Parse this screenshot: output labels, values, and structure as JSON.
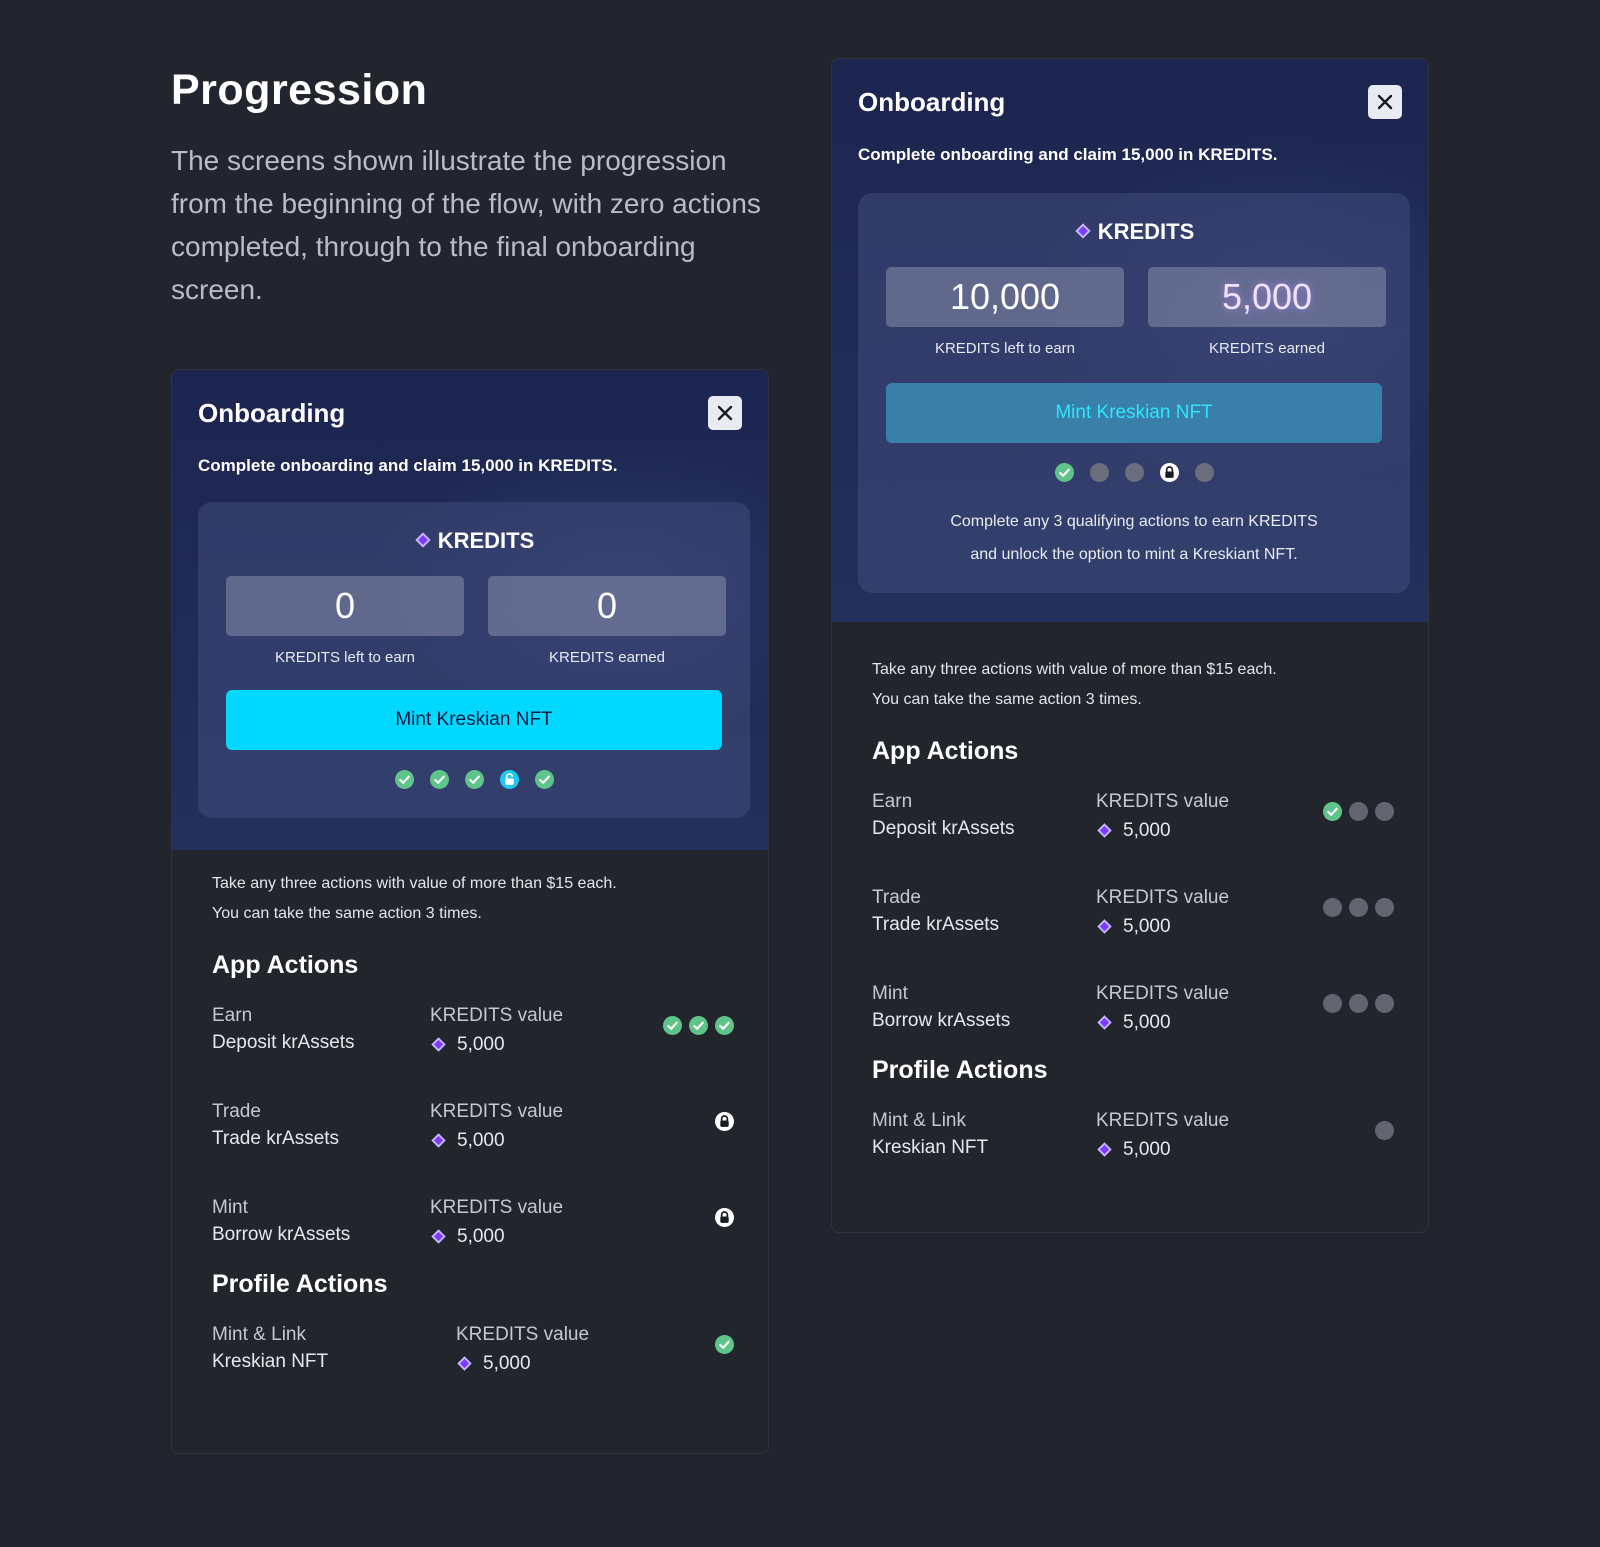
{
  "intro": {
    "title": "Progression",
    "description": "The screens shown illustrate the progression from the beginning of the flow, with zero actions completed, through to the final onboarding screen."
  },
  "colors": {
    "background": "#23252e",
    "accent_cyan": "#00d8ff",
    "success_green": "#5fc489",
    "diamond_purple": "#9b6bff"
  },
  "left": {
    "title": "Onboarding",
    "subtitle": "Complete onboarding and claim 15,000 in KREDITS.",
    "kredits_heading": "KREDITS",
    "left_to_earn_value": "0",
    "left_to_earn_label": "KREDITS left to earn",
    "earned_value": "0",
    "earned_label": "KREDITS earned",
    "mint_button": "Mint Kreskian NFT",
    "rules_line1": "Take any three actions with value of more than $15 each.",
    "rules_line2": "You can take the same action 3 times.",
    "app_actions_title": "App Actions",
    "profile_actions_title": "Profile Actions",
    "actions": [
      {
        "category": "Earn",
        "name": "Deposit krAssets",
        "kredits_label": "KREDITS value",
        "kredits_value": "5,000"
      },
      {
        "category": "Trade",
        "name": "Trade krAssets",
        "kredits_label": "KREDITS value",
        "kredits_value": "5,000"
      },
      {
        "category": "Mint",
        "name": "Borrow krAssets",
        "kredits_label": "KREDITS value",
        "kredits_value": "5,000"
      }
    ],
    "profile": {
      "category": "Mint & Link",
      "name": "Kreskian NFT",
      "kredits_label": "KREDITS value",
      "kredits_value": "5,000"
    }
  },
  "right": {
    "title": "Onboarding",
    "subtitle": "Complete onboarding and claim 15,000 in KREDITS.",
    "kredits_heading": "KREDITS",
    "left_to_earn_value": "10,000",
    "left_to_earn_label": "KREDITS left to earn",
    "earned_value": "5,000",
    "earned_label": "KREDITS earned",
    "mint_button": "Mint Kreskian NFT",
    "description_line1": "Complete any 3 qualifying actions to earn KREDITS",
    "description_line2": "and unlock the option to mint a Kreskiant NFT.",
    "rules_line1": "Take any three actions with value of more than $15 each.",
    "rules_line2": "You can take the same action 3 times.",
    "app_actions_title": "App Actions",
    "profile_actions_title": "Profile Actions",
    "actions": [
      {
        "category": "Earn",
        "name": "Deposit krAssets",
        "kredits_label": "KREDITS value",
        "kredits_value": "5,000"
      },
      {
        "category": "Trade",
        "name": "Trade krAssets",
        "kredits_label": "KREDITS value",
        "kredits_value": "5,000"
      },
      {
        "category": "Mint",
        "name": "Borrow krAssets",
        "kredits_label": "KREDITS value",
        "kredits_value": "5,000"
      }
    ],
    "profile": {
      "category": "Mint & Link",
      "name": "Kreskian NFT",
      "kredits_label": "KREDITS value",
      "kredits_value": "5,000"
    }
  }
}
